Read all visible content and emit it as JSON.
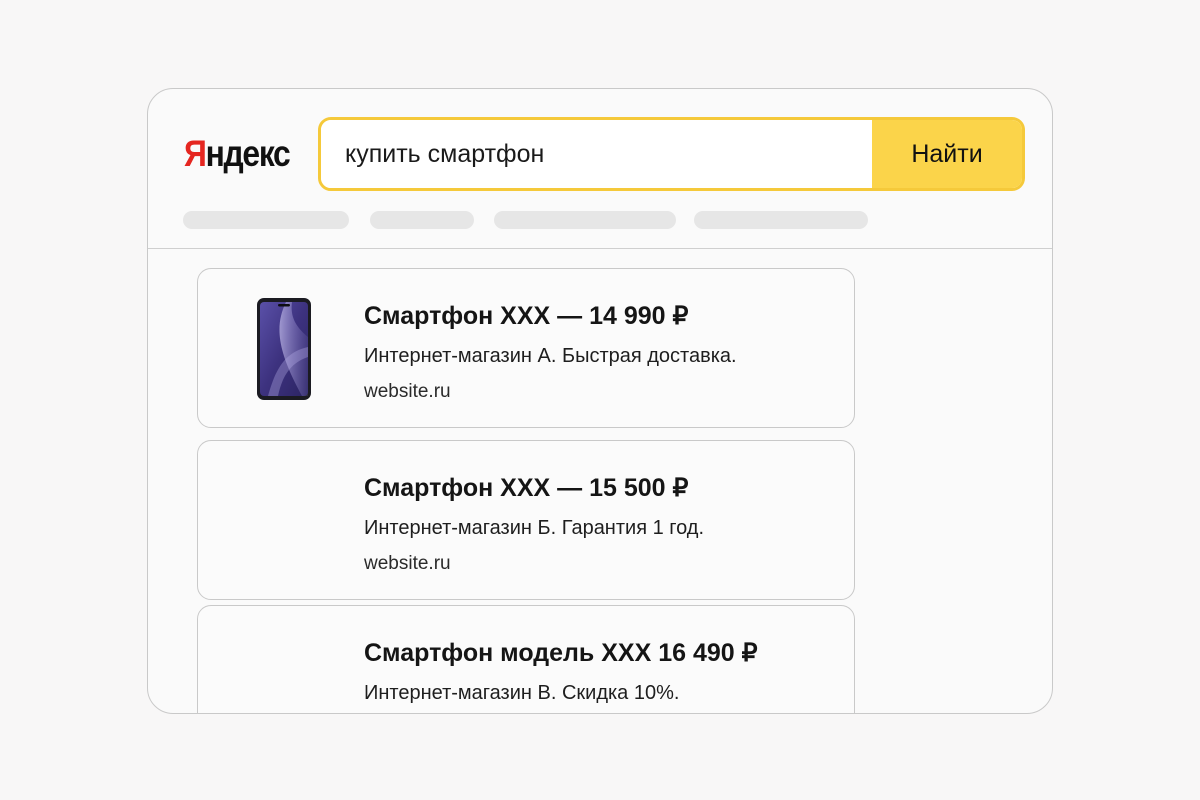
{
  "header": {
    "logo": {
      "first_letter": "Я",
      "rest": "ндекс"
    },
    "search": {
      "query": "купить смартфон",
      "button_label": "Найти"
    }
  },
  "results": [
    {
      "title": "Смартфон XXX — 14 990 ₽",
      "snippet": "Интернет-магазин А. Быстрая доставка.",
      "url": "website.ru",
      "has_image": true
    },
    {
      "title": "Смартфон XXX — 15 500 ₽",
      "snippet": "Интернет-магазин Б. Гарантия 1 год.",
      "url": "website.ru",
      "has_image": false
    },
    {
      "title": "Смартфон модель XXX  16 490 ₽",
      "snippet": "Интернет-магазин В. Скидка 10%.",
      "url": "",
      "has_image": false
    }
  ],
  "colors": {
    "logo_accent": "#e52620",
    "search_border": "#f5c93a",
    "search_button": "#fbd44a",
    "phone_screen": "#4a3f95"
  },
  "icons": {
    "product_image": "smartphone-image"
  }
}
